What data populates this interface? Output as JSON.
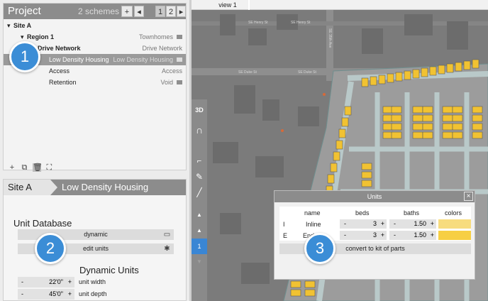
{
  "project": {
    "title": "Project",
    "schemes_label": "2 schemes",
    "add_label": "+",
    "prev_label": "◂",
    "pages": [
      "1",
      "2"
    ],
    "next_label": "▸"
  },
  "tree": [
    {
      "label": "Site A",
      "value": ""
    },
    {
      "label": "Region 1",
      "value": "Townhomes"
    },
    {
      "label": "Drive Network",
      "value": "Drive Network"
    },
    {
      "label": "Low Density Housing",
      "value": "Low Density Housing"
    },
    {
      "label": "Access",
      "value": "Access"
    },
    {
      "label": "Retention",
      "value": "Void"
    }
  ],
  "breadcrumb": {
    "site": "Site A",
    "item": "Low Density Housing"
  },
  "unit_database": {
    "title": "Unit Database",
    "dynamic_label": "dynamic",
    "edit_units_label": "edit units"
  },
  "dynamic_units": {
    "title": "Dynamic Units",
    "fields": [
      {
        "minus": "-",
        "value": "22'0\"",
        "plus": "+",
        "label": "unit width"
      },
      {
        "minus": "-",
        "value": "45'0\"",
        "plus": "+",
        "label": "unit depth"
      }
    ]
  },
  "view_tab": "view 1",
  "vertical_tools": {
    "label_3d": "3D",
    "page": "1"
  },
  "map_labels": [
    "SE Henry St",
    "SE Henry St",
    "SE 35th Ave",
    "SE Duke St",
    "SE Duke St"
  ],
  "units_dialog": {
    "title": "Units",
    "close_label": "×",
    "headers": {
      "name": "name",
      "beds": "beds",
      "baths": "baths",
      "colors": "colors"
    },
    "rows": [
      {
        "code": "I",
        "name": "Inline",
        "beds": "3",
        "baths": "1.50",
        "minus": "-",
        "plus": "+",
        "color": "#f7dc7e"
      },
      {
        "code": "E",
        "name": "Endcap",
        "beds": "3",
        "baths": "1.50",
        "minus": "-",
        "plus": "+",
        "color": "#f7cf44"
      }
    ],
    "kit_label": "convert to kit of parts"
  },
  "callouts": [
    "1",
    "2",
    "3"
  ],
  "colors": {
    "accent": "#3b8dd6",
    "header_gray": "#8c8c8c",
    "building_yellow": "#f1c232"
  }
}
